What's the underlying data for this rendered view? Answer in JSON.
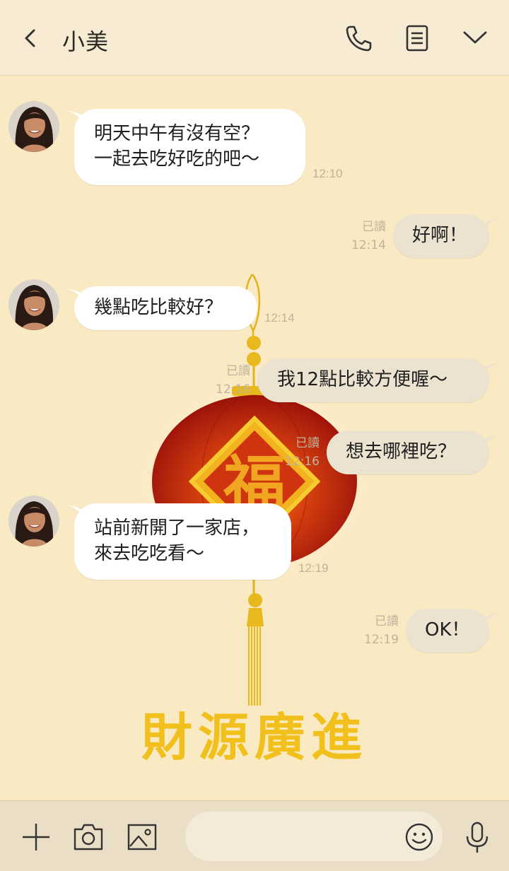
{
  "header": {
    "contact_name": "小美"
  },
  "messages": [
    {
      "side": "in",
      "lines": [
        "明天中午有沒有空？",
        "一起去吃好吃的吧～"
      ],
      "time": "12:10"
    },
    {
      "side": "out",
      "text": "好啊！",
      "read": "已讀",
      "time": "12:14"
    },
    {
      "side": "in",
      "lines": [
        "幾點吃比較好？"
      ],
      "time": "12:14"
    },
    {
      "side": "out",
      "text": "我12點比較方便喔～",
      "read": "已讀",
      "time": "12:16"
    },
    {
      "side": "out",
      "text": "想去哪裡吃？",
      "read": "已讀",
      "time": "12:16"
    },
    {
      "side": "in",
      "lines": [
        "站前新開了一家店，",
        "來去吃吃看～"
      ],
      "time": "12:19"
    },
    {
      "side": "out",
      "text": "OK！",
      "read": "已讀",
      "time": "12:19"
    }
  ],
  "background": {
    "lantern_character": "福",
    "banner_text": "財源廣進"
  },
  "colors": {
    "chat_bg": "#faeac4",
    "lantern_red": "#c8200e",
    "gold": "#f1c01c",
    "out_bubble": "#ebe2cf"
  },
  "icons": [
    "chevron-left-icon",
    "phone-icon",
    "notes-icon",
    "chevron-down-icon",
    "plus-icon",
    "camera-icon",
    "image-icon",
    "emoji-icon",
    "microphone-icon"
  ]
}
